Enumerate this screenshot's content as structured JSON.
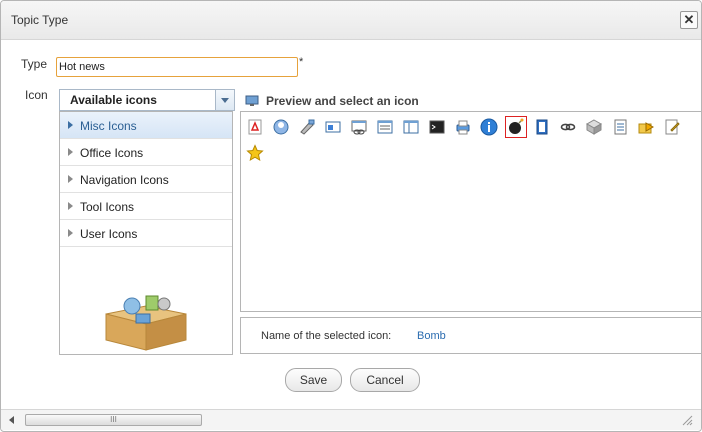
{
  "dialog": {
    "title": "Topic Type"
  },
  "form": {
    "type_label": "Type",
    "type_value": "Hot news",
    "required_mark": "*",
    "icon_label": "Icon"
  },
  "icon_select": {
    "selected": "Available icons"
  },
  "categories": [
    {
      "label": "Misc Icons",
      "selected": true
    },
    {
      "label": "Office Icons",
      "selected": false
    },
    {
      "label": "Navigation Icons",
      "selected": false
    },
    {
      "label": "Tool Icons",
      "selected": false
    },
    {
      "label": "User Icons",
      "selected": false
    }
  ],
  "preview": {
    "heading": "Preview and select an icon"
  },
  "icons": [
    {
      "name": "pdf-icon"
    },
    {
      "name": "user-globe-icon"
    },
    {
      "name": "tool-icon"
    },
    {
      "name": "window-icon"
    },
    {
      "name": "window-link-icon"
    },
    {
      "name": "text-window-icon"
    },
    {
      "name": "layout-window-icon"
    },
    {
      "name": "terminal-icon"
    },
    {
      "name": "printer-icon"
    },
    {
      "name": "info-icon"
    },
    {
      "name": "bomb-icon",
      "selected": true
    },
    {
      "name": "book-icon"
    },
    {
      "name": "link-icon"
    },
    {
      "name": "cube-icon"
    },
    {
      "name": "list-icon"
    },
    {
      "name": "folder-arrow-icon"
    },
    {
      "name": "edit-page-icon"
    },
    {
      "name": "star-icon"
    }
  ],
  "selection": {
    "label": "Name of the selected icon:",
    "value": "Bomb"
  },
  "buttons": {
    "save": "Save",
    "cancel": "Cancel"
  },
  "scrollbar": {
    "thumb_grip": "III"
  },
  "colors": {
    "accent_blue": "#2b6cb0",
    "selection_red": "#d22222",
    "input_focus": "#e6a23c"
  }
}
